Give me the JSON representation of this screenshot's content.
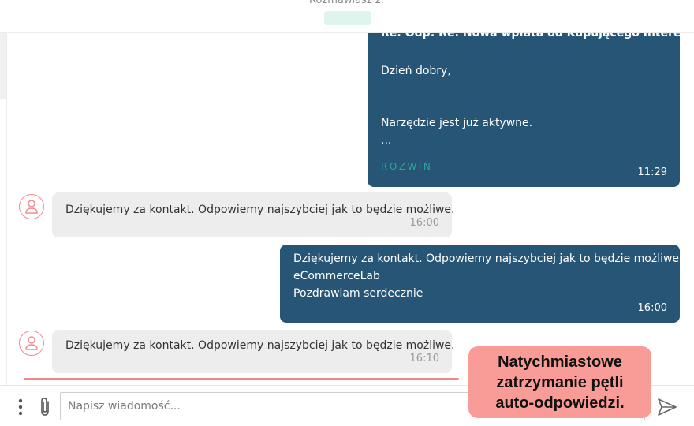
{
  "header": {
    "title": "Rozmawiasz z:"
  },
  "messages": [
    {
      "direction": "outgoing",
      "subject": "Re: Odp: Re: Nowa wpłata od Kupującego Intereco",
      "lines": [
        "Dzień dobry,",
        "Narzędzie jest już aktywne.",
        "..."
      ],
      "expand_label": "ROZWIŃ",
      "time": "11:29"
    },
    {
      "direction": "incoming",
      "text": "Dziękujemy za kontakt. Odpowiemy najszybciej jak to będzie możliwe.",
      "time": "16:00"
    },
    {
      "direction": "outgoing",
      "lines": [
        "Dziękujemy za kontakt. Odpowiemy najszybciej jak to będzie możliwe.",
        "eCommerceLab",
        "Pozdrawiam serdecznie"
      ],
      "time": "16:00"
    },
    {
      "direction": "incoming",
      "text": "Dziękujemy za kontakt. Odpowiemy najszybciej jak to będzie możliwe.",
      "time": "16:10"
    }
  ],
  "annotation": {
    "lines": [
      "Natychmiastowe",
      "zatrzymanie pętli",
      "auto-odpowiedzi."
    ]
  },
  "composer": {
    "placeholder": "Napisz wiadomość...",
    "value": ""
  },
  "icons": {
    "more": "more-vertical-icon",
    "attach": "paperclip-icon",
    "send": "send-icon",
    "avatar": "user-icon"
  },
  "colors": {
    "outgoing_bubble": "#275575",
    "incoming_bubble": "#ededed",
    "expand_link": "#27a89a",
    "avatar_border": "#ee8e8e",
    "annotation_bg": "#f99c97",
    "highlight_line": "#f08a8a"
  }
}
